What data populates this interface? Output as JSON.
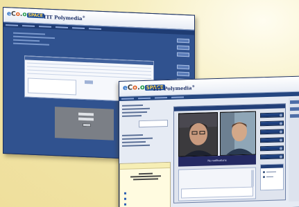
{
  "back_window": {
    "logo": {
      "e": "e",
      "c": "C",
      "o1": "o",
      "dot": ".",
      "o2": "o",
      "space": "SPACE"
    },
    "brand": "TIT Polymedia",
    "brand_mark": "®"
  },
  "front_window": {
    "logo": {
      "e": "e",
      "c": "C",
      "o1": "o",
      "dot": ".",
      "o2": "o",
      "space": "SPACE"
    },
    "brand": "TIT Polymedia",
    "brand_mark": "®",
    "video_caption": "No notifications",
    "colors": {
      "accent": "#252a63",
      "panel": "#e6ebf4",
      "header": "#30528f"
    }
  },
  "icons": [
    "video-call-icon",
    "checkbox-icon",
    "settings-icon"
  ]
}
